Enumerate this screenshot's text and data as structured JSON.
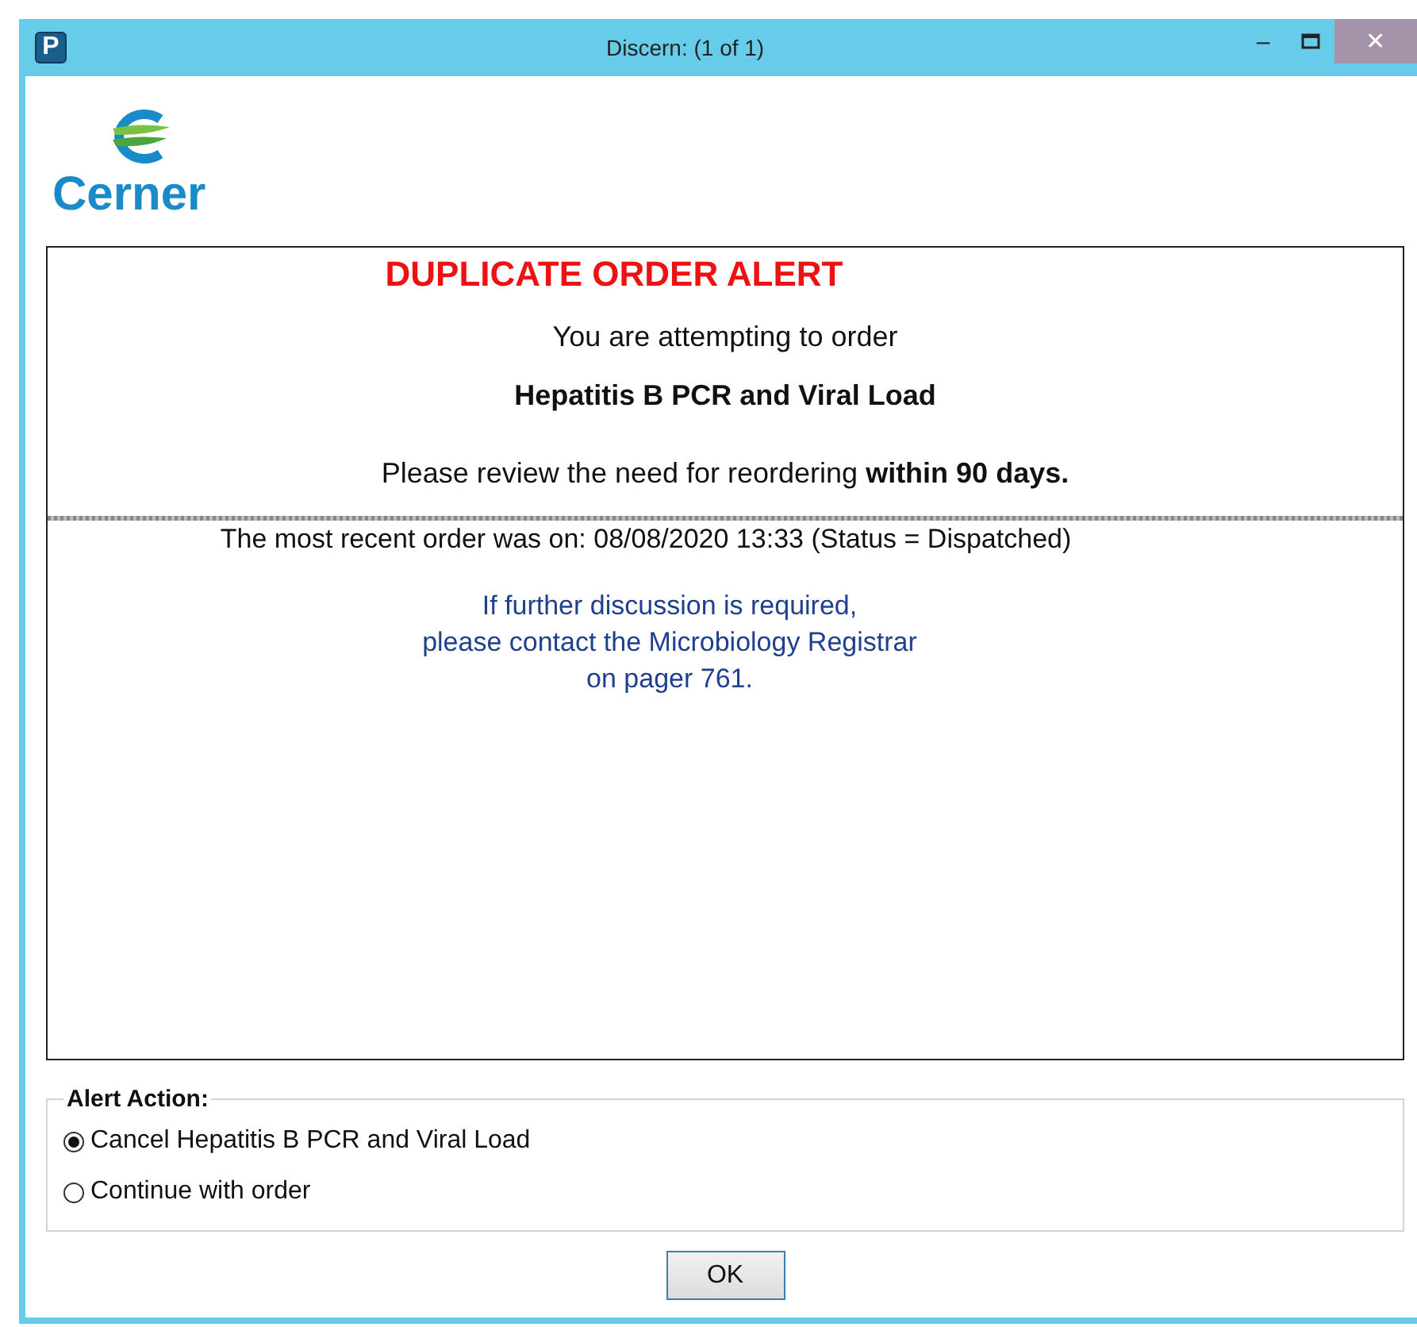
{
  "window": {
    "app_icon": "P",
    "title": "Discern:  (1 of 1)",
    "controls": {
      "minimize": "–",
      "close": "✕"
    }
  },
  "logo": {
    "wordmark": "Cerner"
  },
  "alert": {
    "heading": "DUPLICATE ORDER ALERT",
    "intro": "You are attempting to order",
    "order_name": "Hepatitis B PCR and Viral Load",
    "review": "Please review the need for reordering **within 90 days.**",
    "recent": "The most recent order was on: 08/08/2020 13:33 (Status = Dispatched)",
    "contact": [
      "If further discussion is required,",
      "please contact the Microbiology Registrar",
      "on pager 761."
    ]
  },
  "alert_action": {
    "legend": "Alert Action:",
    "options": [
      {
        "label": "Cancel Hepatitis B PCR and Viral Load",
        "selected": true
      },
      {
        "label": "Continue with order",
        "selected": false
      }
    ]
  },
  "buttons": [
    "OK"
  ]
}
